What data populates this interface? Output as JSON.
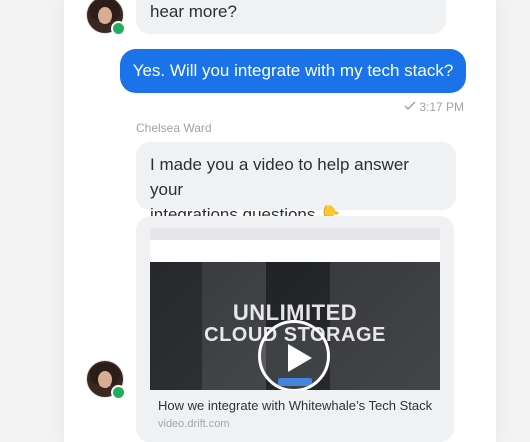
{
  "messages": [
    {
      "sender": "agent",
      "text": "hear more?"
    },
    {
      "sender": "user",
      "text": "Yes. Will you integrate with my tech stack?"
    },
    {
      "sender": "agent",
      "name": "Chelsea Ward",
      "line1": "I made you a video to help answer your",
      "line2": "integrations questions",
      "emoji": "👇"
    }
  ],
  "delivery": {
    "icon": "checkmark-icon",
    "time": "3:17 PM"
  },
  "video_card": {
    "headline_line1": "UNLIMITED",
    "headline_line2": "CLOUD STORAGE",
    "title": "How we integrate with Whitewhale’s Tech Stack",
    "domain": "video.drift.com"
  },
  "colors": {
    "user_bubble": "#1a73e8",
    "agent_bubble": "#f0f1f3",
    "presence": "#1fae5b"
  }
}
